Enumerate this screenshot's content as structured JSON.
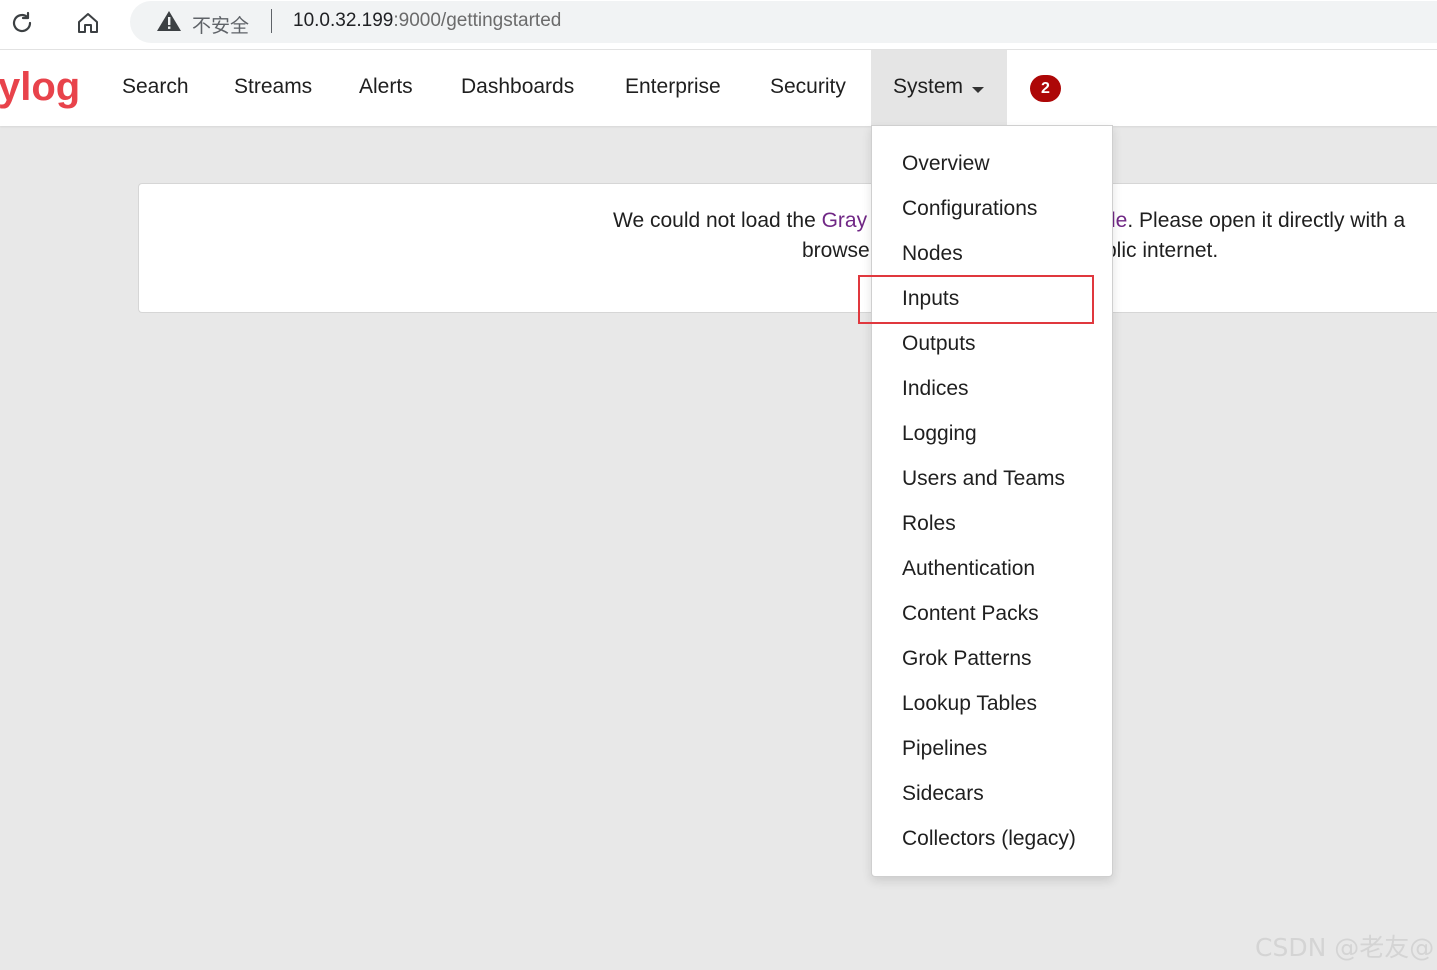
{
  "browser": {
    "insecure_label": "不安全",
    "url_host": "10.0.32.199",
    "url_rest": ":9000/gettingstarted"
  },
  "nav": {
    "logo_text": "ylog",
    "items": [
      "Search",
      "Streams",
      "Alerts",
      "Dashboards",
      "Enterprise",
      "Security"
    ],
    "system_label": "System",
    "notification_count": "2"
  },
  "message": {
    "line1_a": "We could not load the ",
    "line1_link": "Gray",
    "line1_link2": "le",
    "line1_b": ". Please open it directly with a",
    "line2_a": "browse",
    "line2_b": "blic internet."
  },
  "system_menu": {
    "items": [
      "Overview",
      "Configurations",
      "Nodes",
      "Inputs",
      "Outputs",
      "Indices",
      "Logging",
      "Users and Teams",
      "Roles",
      "Authentication",
      "Content Packs",
      "Grok Patterns",
      "Lookup Tables",
      "Pipelines",
      "Sidecars",
      "Collectors (legacy)"
    ],
    "highlighted": "Inputs"
  },
  "watermark": "CSDN @老友@",
  "colors": {
    "accent_red": "#e0383e",
    "logo_red": "#e8434b",
    "link_purple": "#702785",
    "badge_red": "#ad0707"
  }
}
